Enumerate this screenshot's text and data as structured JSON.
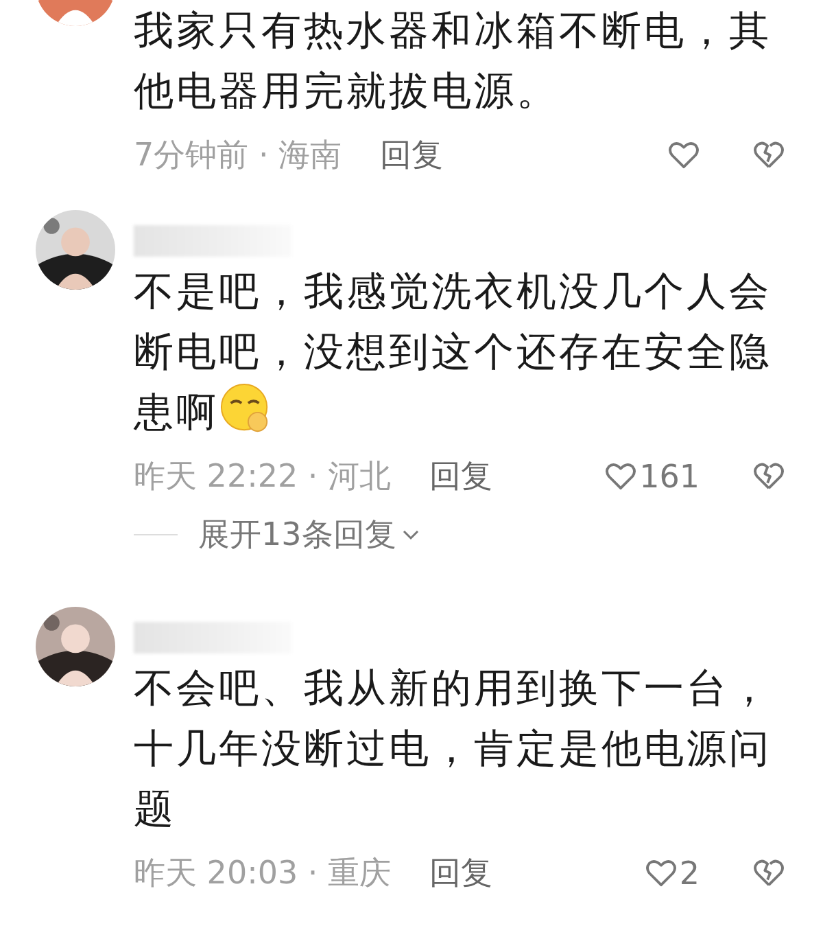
{
  "comments": [
    {
      "text": "我家只有热水器和冰箱不断电，其他电器用完就拔电源。",
      "emoji": false,
      "time": "7分钟前",
      "separator": "·",
      "location": "海南",
      "reply": "回复"
    },
    {
      "name_blurred": true,
      "text": "不是吧，我感觉洗衣机没几个人会断电吧，没想到这个还存在安全隐患啊",
      "emoji": true,
      "time": "昨天 22:22",
      "separator": "·",
      "location": "河北",
      "reply": "回复",
      "likes": "161",
      "expand": "展开13条回复"
    },
    {
      "name_blurred": true,
      "text": "不会吧、我从新的用到换下一台，十几年没断过电，肯定是他电源问题",
      "emoji": false,
      "time": "昨天 20:03",
      "separator": "·",
      "location": "重庆",
      "reply": "回复",
      "likes": "2"
    }
  ]
}
